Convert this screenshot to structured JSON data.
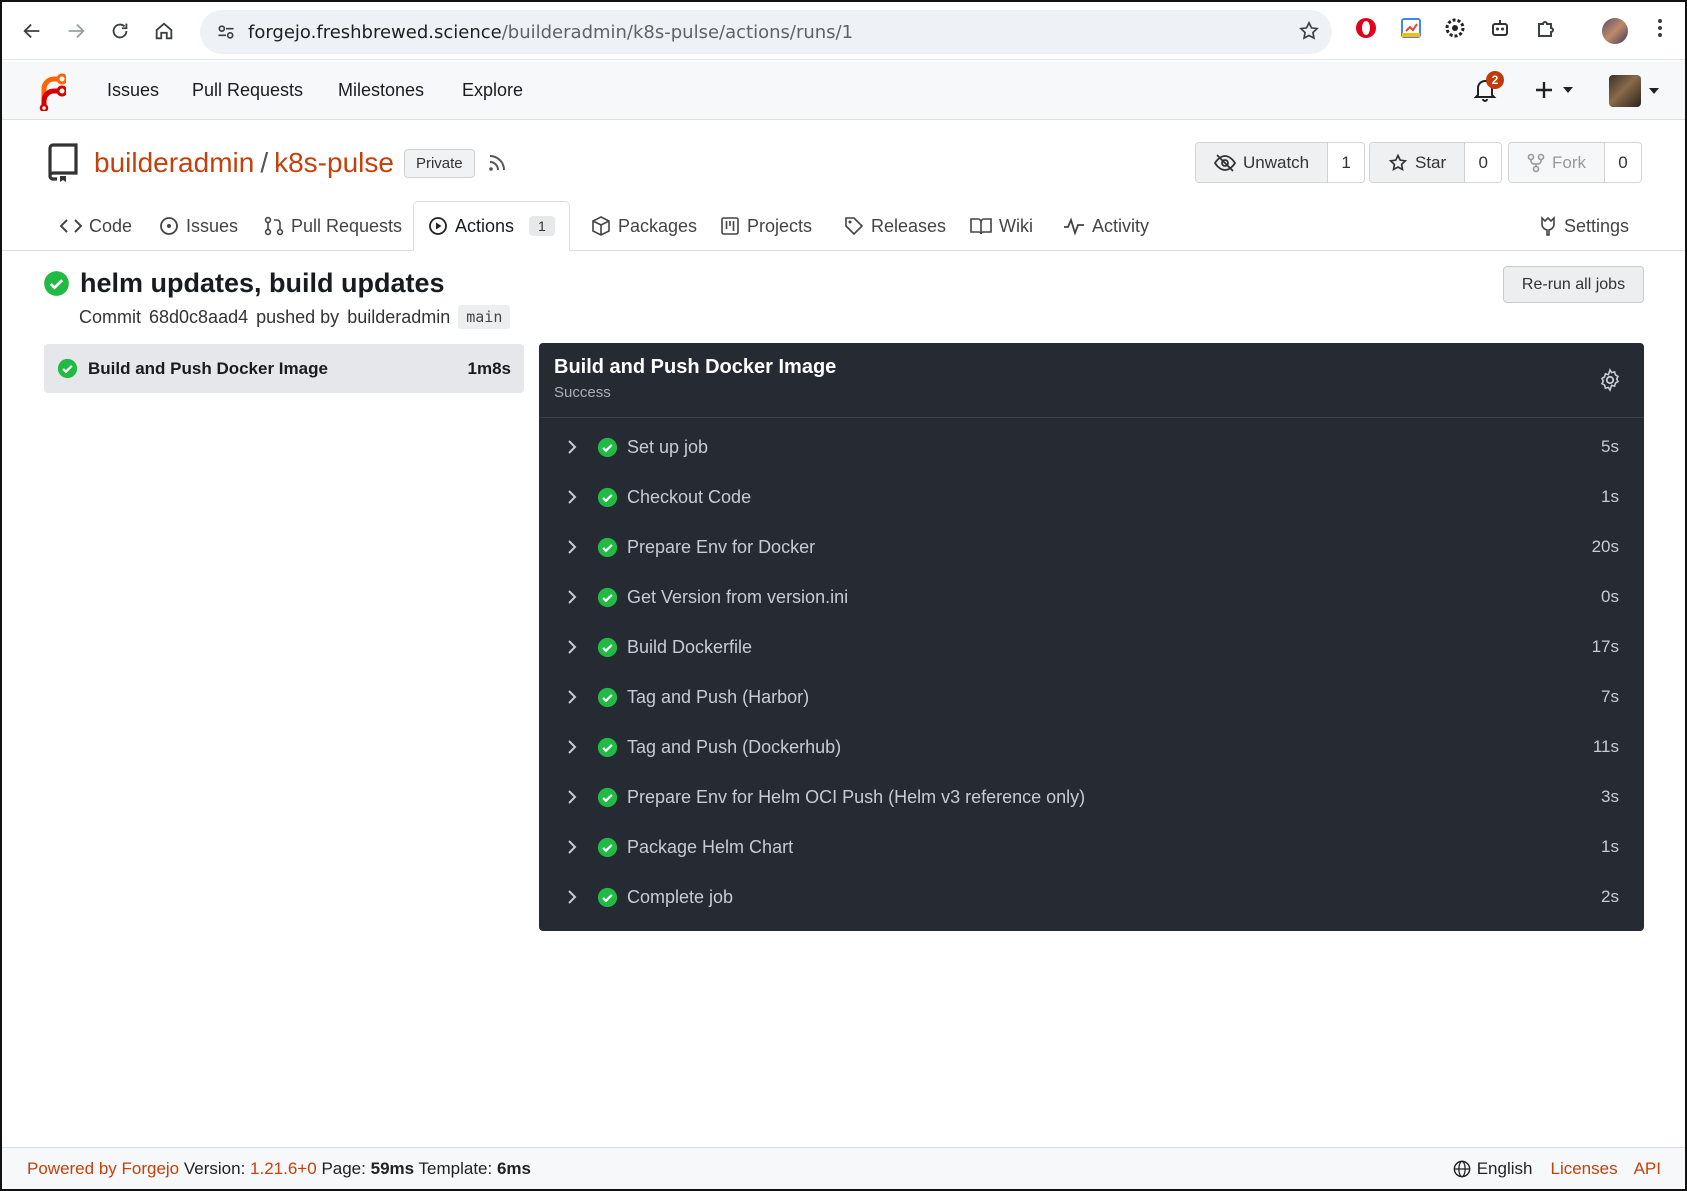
{
  "browser": {
    "url_host": "forgejo.freshbrewed.science",
    "url_path": "/builderadmin/k8s-pulse/actions/runs/1"
  },
  "navbar": {
    "items": [
      "Issues",
      "Pull Requests",
      "Milestones",
      "Explore"
    ],
    "notification_count": "2"
  },
  "repo": {
    "owner": "builderadmin",
    "separator": "/",
    "name": "k8s-pulse",
    "visibility": "Private",
    "unwatch_label": "Unwatch",
    "watch_count": "1",
    "star_label": "Star",
    "star_count": "0",
    "fork_label": "Fork",
    "fork_count": "0"
  },
  "tabs": {
    "code": "Code",
    "issues": "Issues",
    "pulls": "Pull Requests",
    "actions": "Actions",
    "actions_count": "1",
    "packages": "Packages",
    "projects": "Projects",
    "releases": "Releases",
    "wiki": "Wiki",
    "activity": "Activity",
    "settings": "Settings"
  },
  "run": {
    "title": "helm updates, build updates",
    "commit_label": "Commit",
    "commit_sha": "68d0c8aad4",
    "pushed_by_label": "pushed by",
    "author": "builderadmin",
    "branch": "main",
    "rerun_label": "Re-run all jobs"
  },
  "jobs": [
    {
      "name": "Build and Push Docker Image",
      "duration": "1m8s"
    }
  ],
  "job_log": {
    "title": "Build and Push Docker Image",
    "status": "Success",
    "steps": [
      {
        "name": "Set up job",
        "duration": "5s"
      },
      {
        "name": "Checkout Code",
        "duration": "1s"
      },
      {
        "name": "Prepare Env for Docker",
        "duration": "20s"
      },
      {
        "name": "Get Version from version.ini",
        "duration": "0s"
      },
      {
        "name": "Build Dockerfile",
        "duration": "17s"
      },
      {
        "name": "Tag and Push (Harbor)",
        "duration": "7s"
      },
      {
        "name": "Tag and Push (Dockerhub)",
        "duration": "11s"
      },
      {
        "name": "Prepare Env for Helm OCI Push (Helm v3 reference only)",
        "duration": "3s"
      },
      {
        "name": "Package Helm Chart",
        "duration": "1s"
      },
      {
        "name": "Complete job",
        "duration": "2s"
      }
    ]
  },
  "footer": {
    "powered_by": "Powered by Forgejo",
    "version_label": "Version:",
    "version": "1.21.6+0",
    "page_label": "Page:",
    "page_time": "59ms",
    "template_label": "Template:",
    "template_time": "6ms",
    "language": "English",
    "licenses": "Licenses",
    "api": "API"
  },
  "colors": {
    "accent": "#c2410c",
    "success": "#21ba45",
    "panel_bg": "#262a33"
  }
}
